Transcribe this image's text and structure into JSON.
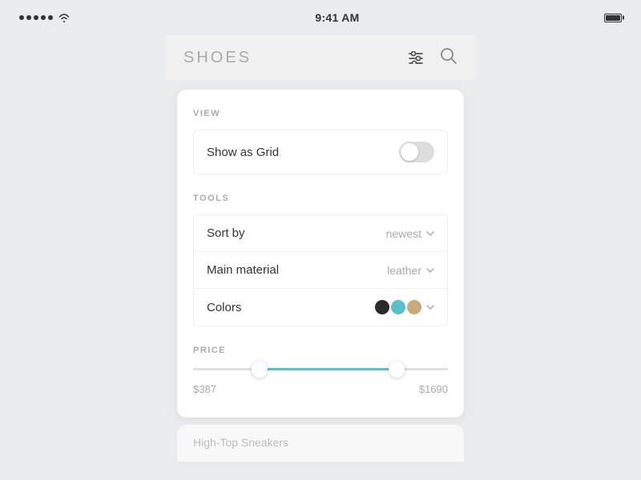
{
  "statusBar": {
    "time": "9:41 AM"
  },
  "header": {
    "title": "SHOES"
  },
  "view": {
    "sectionLabel": "VIEW",
    "gridToggle": {
      "label": "Show as Grid",
      "enabled": false
    }
  },
  "tools": {
    "sectionLabel": "TOOLS",
    "sortBy": {
      "label": "Sort by",
      "value": "newest"
    },
    "mainMaterial": {
      "label": "Main material",
      "value": "leather"
    },
    "colors": {
      "label": "Colors",
      "swatches": [
        "#2a2a2a",
        "#5bbfcb",
        "#c9aa7c"
      ]
    }
  },
  "price": {
    "sectionLabel": "PRICE",
    "min": "$387",
    "max": "$1690"
  },
  "peek": {
    "title": "High-Top Sneakers"
  }
}
